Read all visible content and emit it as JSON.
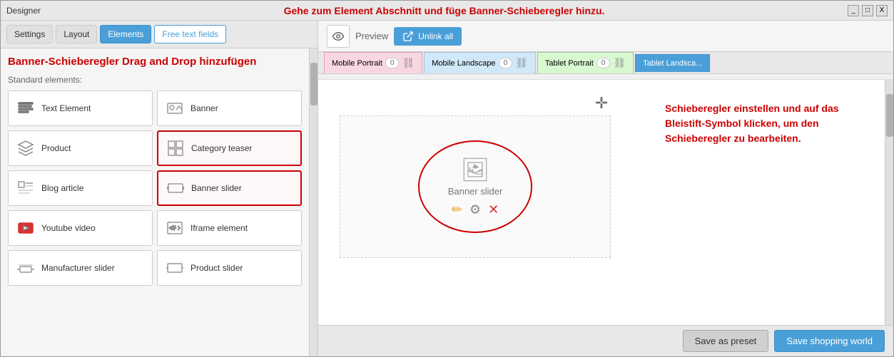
{
  "titleBar": {
    "appName": "Designer",
    "instruction": "Gehe zum Element Abschnitt und füge Banner-Schieberegler hinzu.",
    "controls": [
      "_",
      "□",
      "X"
    ]
  },
  "leftPanel": {
    "tabs": [
      {
        "label": "Settings",
        "active": false
      },
      {
        "label": "Layout",
        "active": false
      },
      {
        "label": "Elements",
        "active": true
      },
      {
        "label": "Free text fields",
        "active": false,
        "outline": true
      }
    ],
    "sectionLabel": "Standard elements:",
    "elements": [
      {
        "id": "text-element",
        "label": "Text Element",
        "icon": "text"
      },
      {
        "id": "banner",
        "label": "Banner",
        "icon": "banner"
      },
      {
        "id": "product",
        "label": "Product",
        "icon": "product"
      },
      {
        "id": "category-teaser",
        "label": "Category teaser",
        "icon": "category",
        "highlighted": true
      },
      {
        "id": "blog-article",
        "label": "Blog article",
        "icon": "blog"
      },
      {
        "id": "banner-slider",
        "label": "Banner slider",
        "icon": "slider",
        "highlighted": true
      },
      {
        "id": "youtube-video",
        "label": "Youtube video",
        "icon": "youtube"
      },
      {
        "id": "iframe-element",
        "label": "Iframe element",
        "icon": "iframe"
      },
      {
        "id": "manufacturer-slider",
        "label": "Manufacturer slider",
        "icon": "manufacturer"
      },
      {
        "id": "product-slider",
        "label": "Product slider",
        "icon": "product-slider"
      }
    ],
    "annotation": "Banner-Schieberegler Drag and Drop hinzufügen"
  },
  "rightPanel": {
    "toolbar": {
      "previewLabel": "Preview",
      "unlinkLabel": "Unlink all"
    },
    "viewportTabs": [
      {
        "label": "Mobile Portrait",
        "count": "0",
        "style": "pink"
      },
      {
        "label": "Mobile Landscape",
        "count": "0",
        "style": "blue"
      },
      {
        "label": "Tablet Portrait",
        "count": "0",
        "style": "green"
      },
      {
        "label": "Tablet Landsca...",
        "count": "",
        "style": "last"
      }
    ],
    "canvas": {
      "widget": {
        "label": "Banner slider"
      },
      "annotation": "Schieberegler einstellen und auf das Bleistift-Symbol klicken, um den Schieberegler zu bearbeiten."
    }
  },
  "bottomBar": {
    "savePresetLabel": "Save as preset",
    "saveWorldLabel": "Save shopping world"
  }
}
